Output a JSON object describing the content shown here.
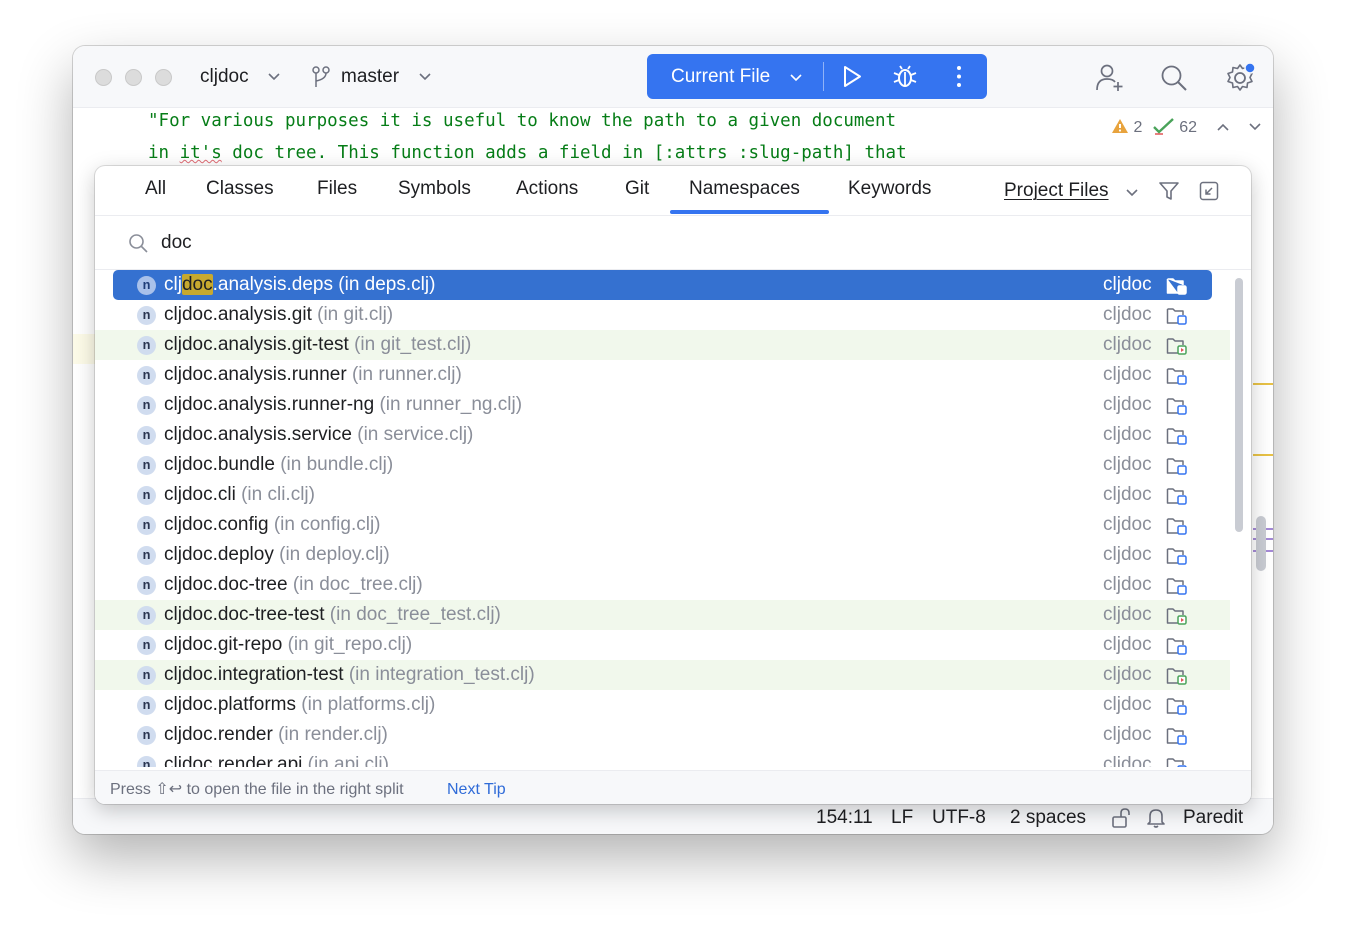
{
  "titlebar": {
    "project": "cljdoc",
    "branch": "master",
    "run_config": "Current File"
  },
  "editor": {
    "lines": [
      "\"For various purposes it is useful to know the path to a given document",
      "in it's doc tree. This function adds a field in [:attrs :slug-path] that"
    ],
    "squiggle_word": "it's",
    "warnings_count": "2",
    "checks_count": "62"
  },
  "popup": {
    "tabs": [
      {
        "label": "All",
        "active": false
      },
      {
        "label": "Classes",
        "active": false
      },
      {
        "label": "Files",
        "active": false
      },
      {
        "label": "Symbols",
        "active": false
      },
      {
        "label": "Actions",
        "active": false
      },
      {
        "label": "Git",
        "active": false
      },
      {
        "label": "Namespaces",
        "active": true
      },
      {
        "label": "Keywords",
        "active": false
      }
    ],
    "scope": "Project Files",
    "search_query": "doc",
    "results": [
      {
        "ns_prefix": "clj",
        "ns_match": "doc",
        "ns_rest": ".analysis.deps",
        "file": "(in deps.clj)",
        "module": "cljdoc",
        "selected": true,
        "test": false
      },
      {
        "ns_prefix": "cljdoc.analysis.git",
        "ns_match": "",
        "ns_rest": "",
        "file": "(in git.clj)",
        "module": "cljdoc",
        "selected": false,
        "test": false
      },
      {
        "ns_prefix": "cljdoc.analysis.git-test",
        "ns_match": "",
        "ns_rest": "",
        "file": "(in git_test.clj)",
        "module": "cljdoc",
        "selected": false,
        "test": true
      },
      {
        "ns_prefix": "cljdoc.analysis.runner",
        "ns_match": "",
        "ns_rest": "",
        "file": "(in runner.clj)",
        "module": "cljdoc",
        "selected": false,
        "test": false
      },
      {
        "ns_prefix": "cljdoc.analysis.runner-ng",
        "ns_match": "",
        "ns_rest": "",
        "file": "(in runner_ng.clj)",
        "module": "cljdoc",
        "selected": false,
        "test": false
      },
      {
        "ns_prefix": "cljdoc.analysis.service",
        "ns_match": "",
        "ns_rest": "",
        "file": "(in service.clj)",
        "module": "cljdoc",
        "selected": false,
        "test": false
      },
      {
        "ns_prefix": "cljdoc.bundle",
        "ns_match": "",
        "ns_rest": "",
        "file": "(in bundle.clj)",
        "module": "cljdoc",
        "selected": false,
        "test": false
      },
      {
        "ns_prefix": "cljdoc.cli",
        "ns_match": "",
        "ns_rest": "",
        "file": "(in cli.clj)",
        "module": "cljdoc",
        "selected": false,
        "test": false
      },
      {
        "ns_prefix": "cljdoc.config",
        "ns_match": "",
        "ns_rest": "",
        "file": "(in config.clj)",
        "module": "cljdoc",
        "selected": false,
        "test": false
      },
      {
        "ns_prefix": "cljdoc.deploy",
        "ns_match": "",
        "ns_rest": "",
        "file": "(in deploy.clj)",
        "module": "cljdoc",
        "selected": false,
        "test": false
      },
      {
        "ns_prefix": "cljdoc.doc-tree",
        "ns_match": "",
        "ns_rest": "",
        "file": "(in doc_tree.clj)",
        "module": "cljdoc",
        "selected": false,
        "test": false
      },
      {
        "ns_prefix": "cljdoc.doc-tree-test",
        "ns_match": "",
        "ns_rest": "",
        "file": "(in doc_tree_test.clj)",
        "module": "cljdoc",
        "selected": false,
        "test": true
      },
      {
        "ns_prefix": "cljdoc.git-repo",
        "ns_match": "",
        "ns_rest": "",
        "file": "(in git_repo.clj)",
        "module": "cljdoc",
        "selected": false,
        "test": false
      },
      {
        "ns_prefix": "cljdoc.integration-test",
        "ns_match": "",
        "ns_rest": "",
        "file": "(in integration_test.clj)",
        "module": "cljdoc",
        "selected": false,
        "test": true
      },
      {
        "ns_prefix": "cljdoc.platforms",
        "ns_match": "",
        "ns_rest": "",
        "file": "(in platforms.clj)",
        "module": "cljdoc",
        "selected": false,
        "test": false
      },
      {
        "ns_prefix": "cljdoc.render",
        "ns_match": "",
        "ns_rest": "",
        "file": "(in render.clj)",
        "module": "cljdoc",
        "selected": false,
        "test": false
      },
      {
        "ns_prefix": "cljdoc.render.api",
        "ns_match": "",
        "ns_rest": "",
        "file": "(in api.clj)",
        "module": "cljdoc",
        "selected": false,
        "test": false
      }
    ],
    "footer_hint": "Press ⇧↩ to open the file in the right split",
    "footer_link": "Next Tip"
  },
  "statusbar": {
    "position": "154:11",
    "line_sep": "LF",
    "encoding": "UTF-8",
    "indent": "2 spaces",
    "mode": "Paredit"
  },
  "colors": {
    "accent": "#3574f0",
    "selection": "#3571d0",
    "test_row": "#f1f8ec",
    "match_highlight": "#c7a92f",
    "string_green": "#067d17"
  },
  "icons": {
    "branch": "git-branch-icon",
    "run": "play-icon",
    "debug": "bug-icon",
    "more": "more-vertical-icon",
    "add_user": "add-user-icon",
    "search": "search-icon",
    "settings": "gear-icon",
    "filter": "filter-icon",
    "collapse": "open-in-window-icon",
    "namespace": "namespace-n-icon",
    "module": "module-folder-icon",
    "test_module": "test-module-folder-icon",
    "lock": "unlock-icon",
    "bell": "bell-icon"
  }
}
